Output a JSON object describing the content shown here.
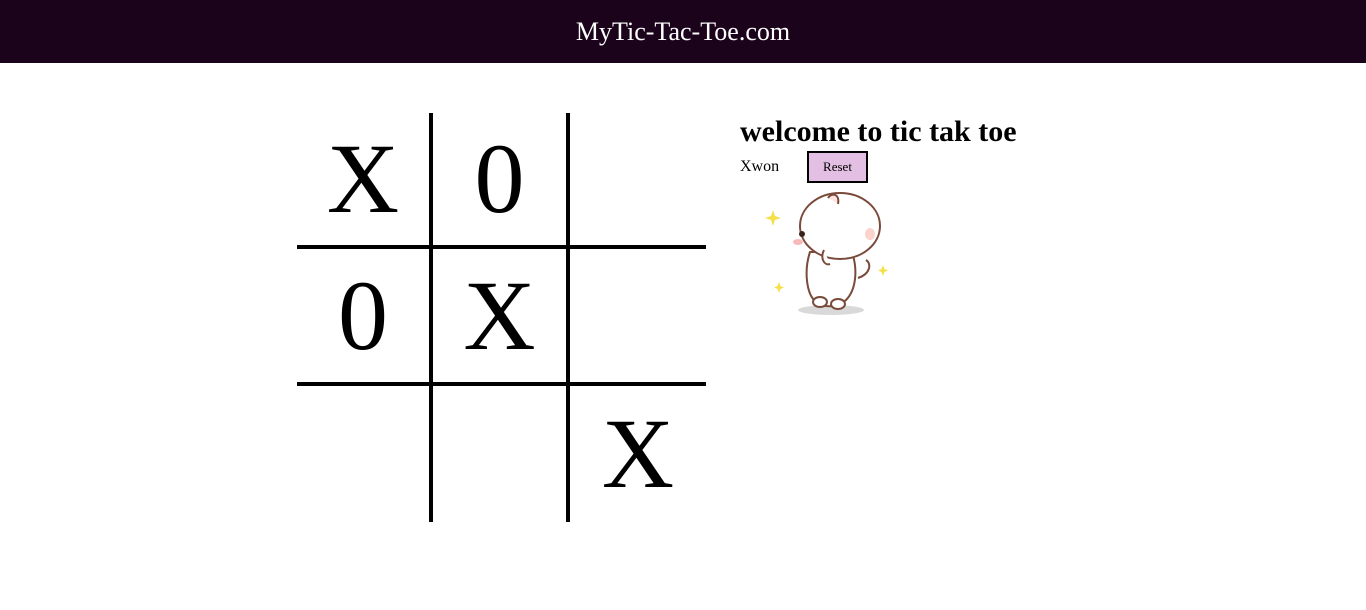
{
  "header": {
    "title": "MyTic-Tac-Toe.com",
    "background": "#1b041b"
  },
  "board": {
    "cells": [
      {
        "mark": "X"
      },
      {
        "mark": "0"
      },
      {
        "mark": ""
      },
      {
        "mark": "0"
      },
      {
        "mark": "X"
      },
      {
        "mark": ""
      },
      {
        "mark": ""
      },
      {
        "mark": ""
      },
      {
        "mark": "X"
      }
    ]
  },
  "info": {
    "heading": "welcome to tic tak toe",
    "status": "Xwon",
    "reset_label": "Reset",
    "reset_color": "#e3c0e3"
  },
  "sticker": {
    "icon": "cute-cat-sticker-icon"
  }
}
